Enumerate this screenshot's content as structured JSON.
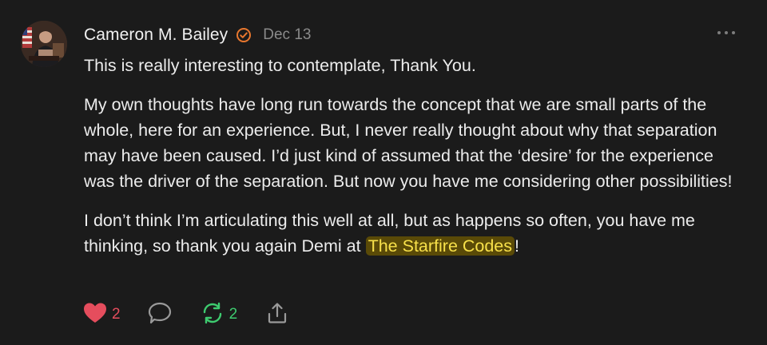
{
  "comment": {
    "author": "Cameron M. Bailey",
    "date": "Dec 13",
    "paragraphs": [
      "This is really interesting to contemplate, Thank You.",
      "My own thoughts have long run towards the concept that we are small parts of the whole, here for an experience. But, I never really thought about why that separation may have been caused. I’d just kind of assumed that the ‘desire’ for the experience was the driver of the separation. But now you have me considering other possibilities!"
    ],
    "last_paragraph": {
      "before": "I don’t think I’m articulating this well at all, but as happens so often, you have me thinking, so thank you again Demi at ",
      "highlight": "The Starfire Codes",
      "after": "!"
    }
  },
  "actions": {
    "like_count": "2",
    "restack_count": "2"
  },
  "icons": {
    "verified": "verified-badge-icon",
    "more": "more-dots-icon",
    "like": "heart-icon",
    "reply": "speech-bubble-icon",
    "restack": "restack-arrows-icon",
    "share": "share-icon"
  },
  "colors": {
    "background": "#1b1b1b",
    "verified": "#e8772e",
    "like": "#e54d5d",
    "restack": "#3ecb6f",
    "highlight_bg": "#5a4a07",
    "highlight_text": "#f7e04a"
  }
}
